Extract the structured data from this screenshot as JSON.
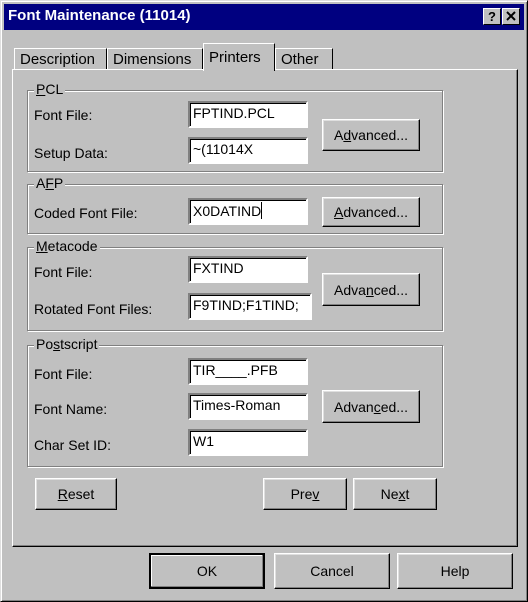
{
  "window": {
    "title": "Font Maintenance (11014)",
    "help_glyph": "?",
    "close_glyph": "x"
  },
  "tabs": [
    {
      "label": "Description",
      "active": false
    },
    {
      "label": "Dimensions",
      "active": false
    },
    {
      "label": "Printers",
      "active": true
    },
    {
      "label": "Other",
      "active": false
    }
  ],
  "pcl": {
    "group_label_pre": "",
    "group_label_mn": "P",
    "group_label_post": "CL",
    "font_file_label": "Font File:",
    "font_file_value": "FPTIND.PCL",
    "setup_data_label": "Setup Data:",
    "setup_data_value": "~(11014X",
    "advanced_pre": "A",
    "advanced_mn": "d",
    "advanced_post": "vanced..."
  },
  "afp": {
    "group_label_pre": "A",
    "group_label_mn": "F",
    "group_label_post": "P",
    "coded_font_file_label": "Coded Font File:",
    "coded_font_file_value": "X0DATIND",
    "advanced_pre": "",
    "advanced_mn": "A",
    "advanced_post": "dvanced..."
  },
  "metacode": {
    "group_label_pre": "",
    "group_label_mn": "M",
    "group_label_post": "etacode",
    "font_file_label": "Font File:",
    "font_file_value": "FXTIND",
    "rotated_label": "Rotated Font Files:",
    "rotated_value": "F9TIND;F1TIND;",
    "advanced_pre": "Adva",
    "advanced_mn": "n",
    "advanced_post": "ced..."
  },
  "postscript": {
    "group_label_pre": "Po",
    "group_label_mn": "s",
    "group_label_post": "tscript",
    "font_file_label": "Font File:",
    "font_file_value": "TIR____.PFB",
    "font_name_label": "Font Name:",
    "font_name_value": "Times-Roman",
    "charset_label": "Char Set ID:",
    "charset_value": "W1",
    "advanced_pre": "Advan",
    "advanced_mn": "c",
    "advanced_post": "ed..."
  },
  "panel_buttons": {
    "reset_pre": "",
    "reset_mn": "R",
    "reset_post": "eset",
    "prev_pre": "Pre",
    "prev_mn": "v",
    "prev_post": "",
    "next_pre": "Ne",
    "next_mn": "x",
    "next_post": "t"
  },
  "dialog_buttons": {
    "ok": "OK",
    "cancel": "Cancel",
    "help": "Help"
  }
}
